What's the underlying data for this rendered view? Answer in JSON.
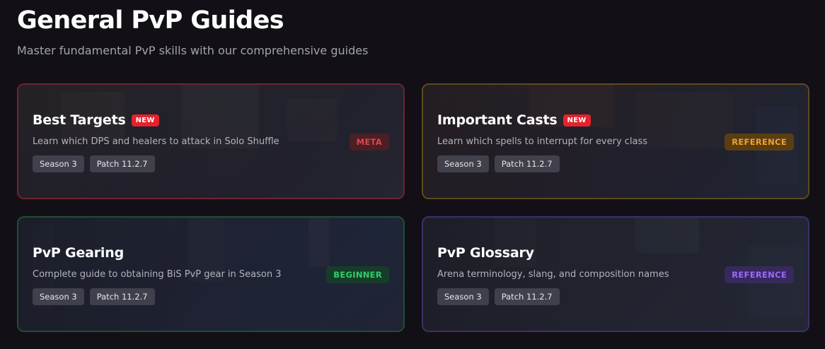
{
  "header": {
    "title": "General PvP Guides",
    "subtitle": "Master fundamental PvP skills with our comprehensive guides"
  },
  "cards": [
    {
      "title": "Best Targets",
      "is_new": true,
      "new_label": "NEW",
      "description": "Learn which DPS and healers to attack in Solo Shuffle",
      "category": "META",
      "tags": [
        "Season 3",
        "Patch 11.2.7"
      ]
    },
    {
      "title": "Important Casts",
      "is_new": true,
      "new_label": "NEW",
      "description": "Learn which spells to interrupt for every class",
      "category": "REFERENCE",
      "tags": [
        "Season 3",
        "Patch 11.2.7"
      ]
    },
    {
      "title": "PvP Gearing",
      "is_new": false,
      "description": "Complete guide to obtaining BiS PvP gear in Season 3",
      "category": "BEGINNER",
      "tags": [
        "Season 3",
        "Patch 11.2.7"
      ]
    },
    {
      "title": "PvP Glossary",
      "is_new": false,
      "description": "Arena terminology, slang, and composition names",
      "category": "REFERENCE",
      "tags": [
        "Season 3",
        "Patch 11.2.7"
      ]
    }
  ],
  "colors": {
    "meta": "#e6414c",
    "reference_orange": "#f0a030",
    "beginner": "#2fcf6a",
    "reference_purple": "#9a6cf4",
    "new_badge": "#e5222d"
  }
}
